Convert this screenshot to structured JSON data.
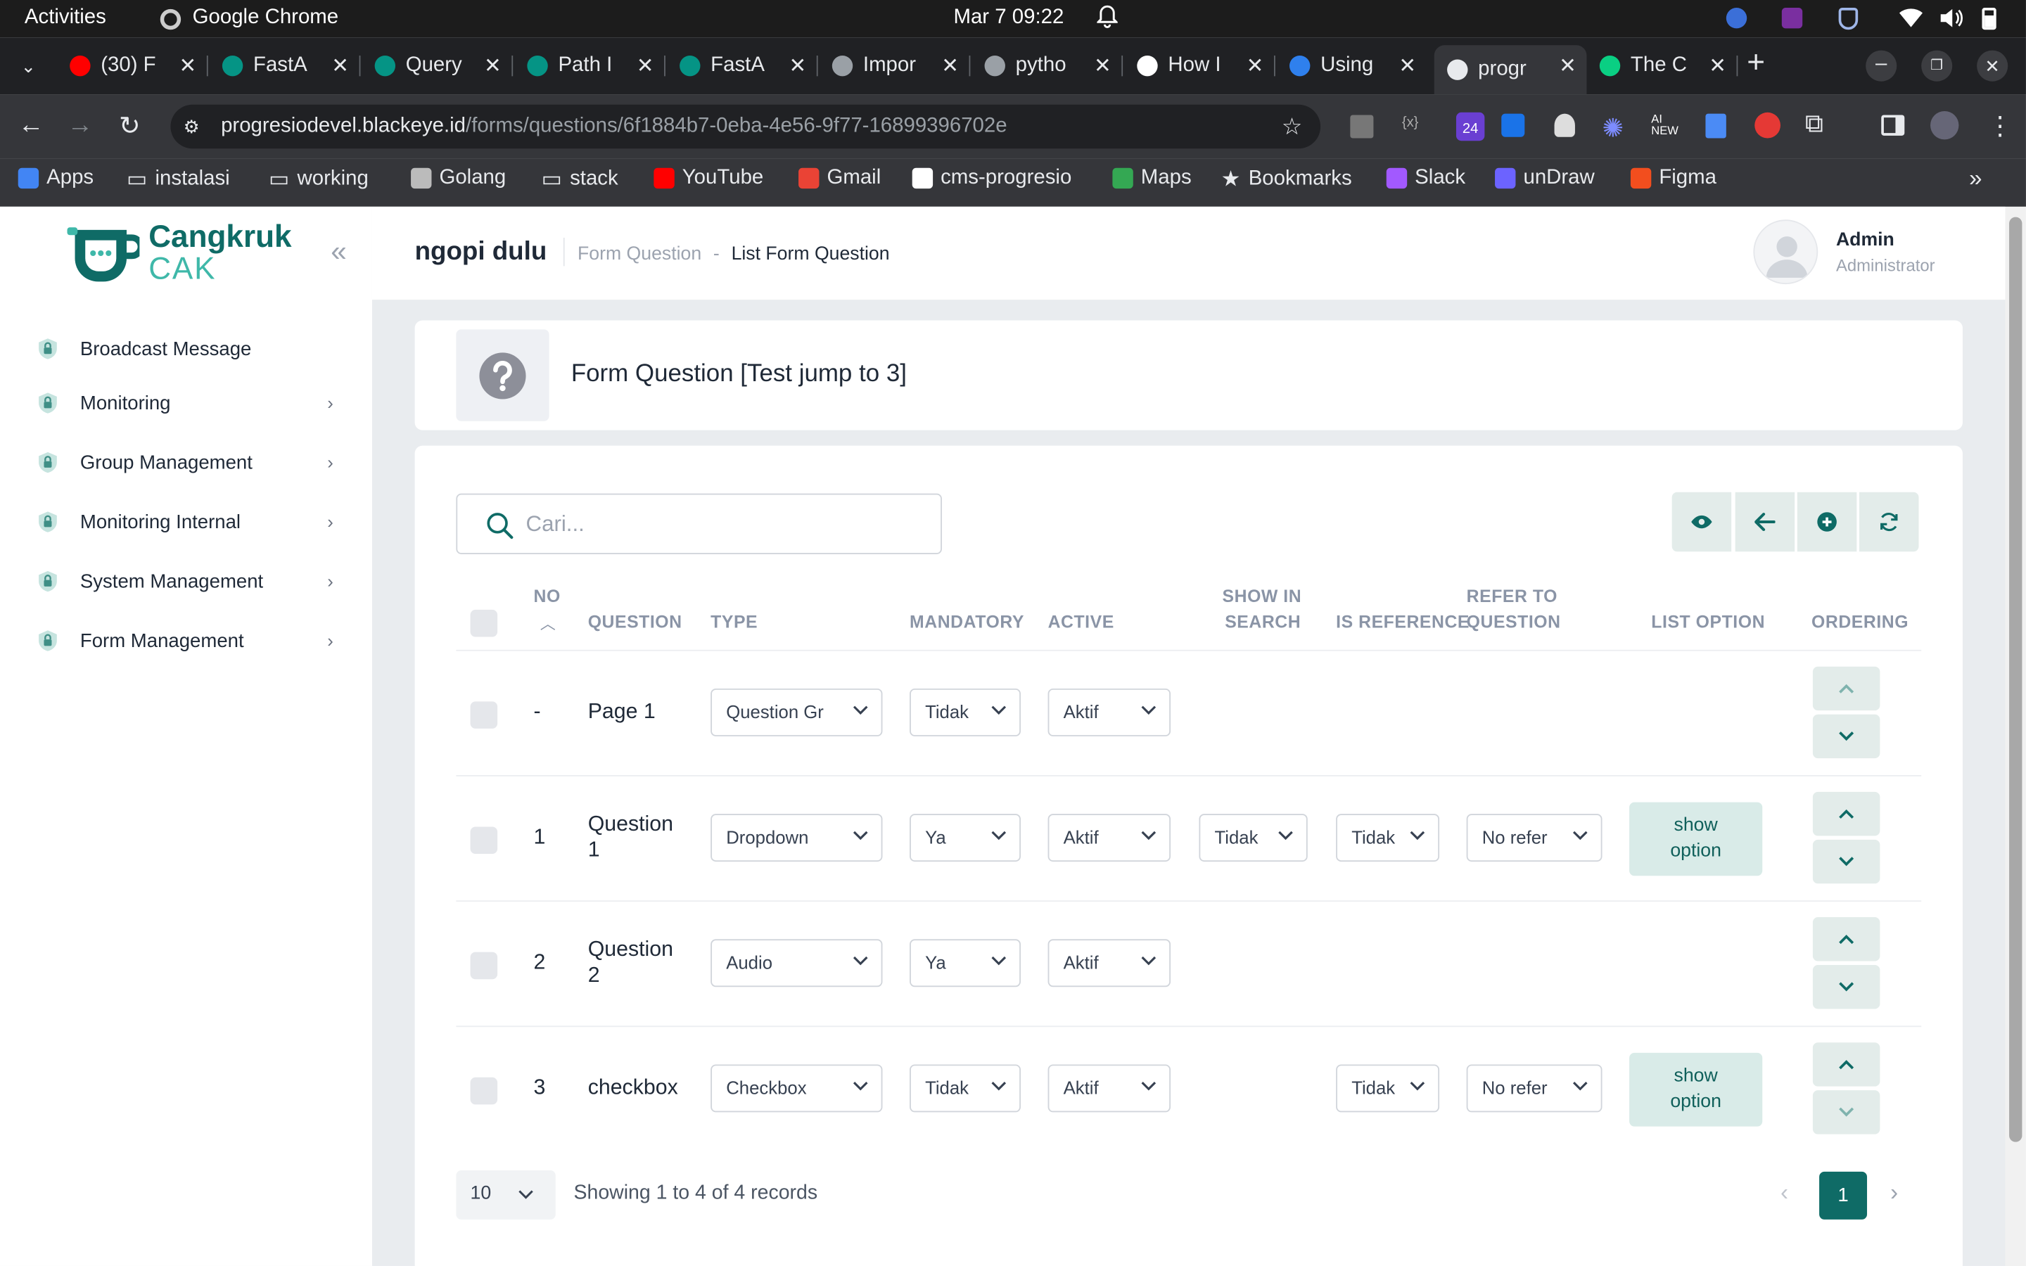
{
  "os": {
    "activities": "Activities",
    "app": "Google Chrome",
    "datetime": "Mar 7  09:22"
  },
  "tabs": [
    {
      "label": "(30) F",
      "icon": "youtube-icon",
      "color": "#ff0000"
    },
    {
      "label": "FastA",
      "icon": "fastapi-icon",
      "color": "#059485"
    },
    {
      "label": "Query",
      "icon": "fastapi-icon",
      "color": "#059485"
    },
    {
      "label": "Path I",
      "icon": "fastapi-icon",
      "color": "#059485"
    },
    {
      "label": "FastA",
      "icon": "fastapi-icon",
      "color": "#059485"
    },
    {
      "label": "Impor",
      "icon": "web-icon",
      "color": "#9aa0a6"
    },
    {
      "label": "pytho",
      "icon": "web-icon",
      "color": "#9aa0a6"
    },
    {
      "label": "How I",
      "icon": "medium-icon",
      "color": "#ffffff"
    },
    {
      "label": "Using",
      "icon": "vscode-icon",
      "color": "#2f80ed"
    },
    {
      "label": "progr",
      "icon": "progresio-icon",
      "color": "#e8eaed"
    },
    {
      "label": "The C",
      "icon": "figma-icon",
      "color": "#0acf83"
    }
  ],
  "url": {
    "host": "progresiodevel.blackeye.id",
    "path": "/forms/questions/6f1884b7-0eba-4e56-9f77-16899396702e"
  },
  "bookmarks": [
    {
      "label": "Apps",
      "icon": "apps-icon"
    },
    {
      "label": "instalasi",
      "icon": "folder-icon"
    },
    {
      "label": "working",
      "icon": "folder-icon"
    },
    {
      "label": "Golang",
      "icon": "book-icon"
    },
    {
      "label": "stack",
      "icon": "folder-icon"
    },
    {
      "label": "YouTube",
      "icon": "youtube-icon"
    },
    {
      "label": "Gmail",
      "icon": "gmail-icon"
    },
    {
      "label": "cms-progresio",
      "icon": "progresio-icon"
    },
    {
      "label": "Maps",
      "icon": "maps-icon"
    },
    {
      "label": "Bookmarks",
      "icon": "star-icon"
    },
    {
      "label": "Slack",
      "icon": "slack-icon"
    },
    {
      "label": "unDraw",
      "icon": "undraw-icon"
    },
    {
      "label": "Figma",
      "icon": "figma-icon"
    }
  ],
  "brand": {
    "line1": "Cangkruk",
    "line2": "CAK",
    "color": "#0f6b66",
    "accent": "#3fb8a9"
  },
  "sidebar": {
    "items": [
      {
        "label": "Broadcast Message",
        "has_chevron": false
      },
      {
        "label": "Monitoring",
        "has_chevron": true
      },
      {
        "label": "Group Management",
        "has_chevron": true
      },
      {
        "label": "Monitoring Internal",
        "has_chevron": true
      },
      {
        "label": "System Management",
        "has_chevron": true
      },
      {
        "label": "Form Management",
        "has_chevron": true
      }
    ]
  },
  "header": {
    "title": "ngopi dulu",
    "crumb1": "Form Question",
    "sep": "-",
    "crumb2": "List Form Question",
    "user_name": "Admin",
    "user_role": "Administrator"
  },
  "form_title": "Form Question [Test jump to 3]",
  "search": {
    "placeholder": "Cari..."
  },
  "columns": {
    "no": "NO",
    "question": "QUESTION",
    "type": "TYPE",
    "mandatory": "MANDATORY",
    "active": "ACTIVE",
    "show_in_search_1": "SHOW IN",
    "show_in_search_2": "SEARCH",
    "is_reference": "IS REFERENCE",
    "refer_1": "REFER TO",
    "refer_2": "QUESTION",
    "list_option": "LIST OPTION",
    "ordering": "ORDERING"
  },
  "rows": [
    {
      "no": "-",
      "question_1": "Page 1",
      "question_2": "",
      "type": "Question Gr",
      "mandatory": "Tidak",
      "active": "Aktif",
      "show_in_search": "",
      "is_reference": "",
      "refer_to": "",
      "list_option": ""
    },
    {
      "no": "1",
      "question_1": "Question",
      "question_2": "1",
      "type": "Dropdown",
      "mandatory": "Ya",
      "active": "Aktif",
      "show_in_search": "Tidak",
      "is_reference": "Tidak",
      "refer_to": "No refer",
      "list_option": "show option"
    },
    {
      "no": "2",
      "question_1": "Question",
      "question_2": "2",
      "type": "Audio",
      "mandatory": "Ya",
      "active": "Aktif",
      "show_in_search": "",
      "is_reference": "",
      "refer_to": "",
      "list_option": ""
    },
    {
      "no": "3",
      "question_1": "checkbox",
      "question_2": "",
      "type": "Checkbox",
      "mandatory": "Tidak",
      "active": "Aktif",
      "show_in_search": "",
      "is_reference": "Tidak",
      "refer_to": "No refer",
      "list_option": "show option"
    }
  ],
  "list_option": {
    "line1": "show",
    "line2": "option"
  },
  "pagination": {
    "page_size": "10",
    "summary": "Showing 1 to 4 of 4 records",
    "current": "1"
  }
}
